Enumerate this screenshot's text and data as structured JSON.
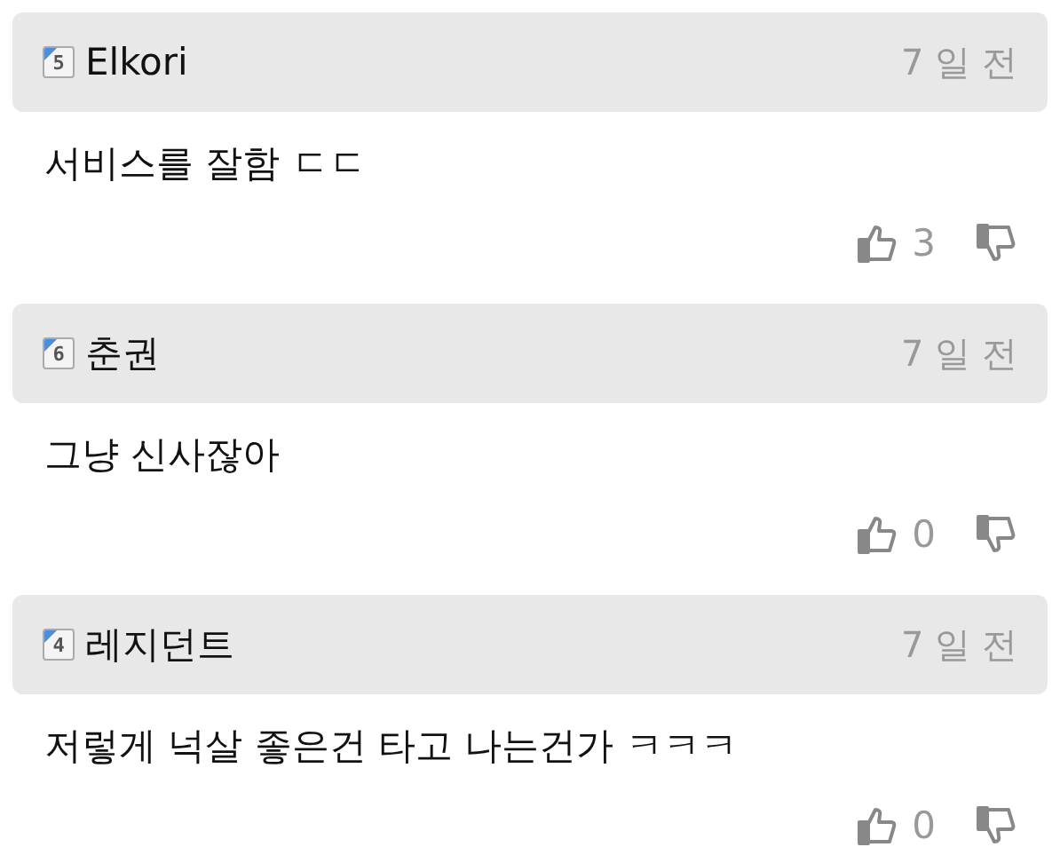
{
  "comments": [
    {
      "level_badge": "5",
      "author": "Elkori",
      "time": "7 일 전",
      "text": "서비스를 잘함 ㄷㄷ",
      "likes": "3"
    },
    {
      "level_badge": "6",
      "author": "춘권",
      "time": "7 일 전",
      "text": "그냥 신사잖아",
      "likes": "0"
    },
    {
      "level_badge": "4",
      "author": "레지던트",
      "time": "7 일 전",
      "text": "저렇게 넉살 좋은건 타고 나는건가 ㅋㅋㅋ",
      "likes": "0"
    }
  ]
}
